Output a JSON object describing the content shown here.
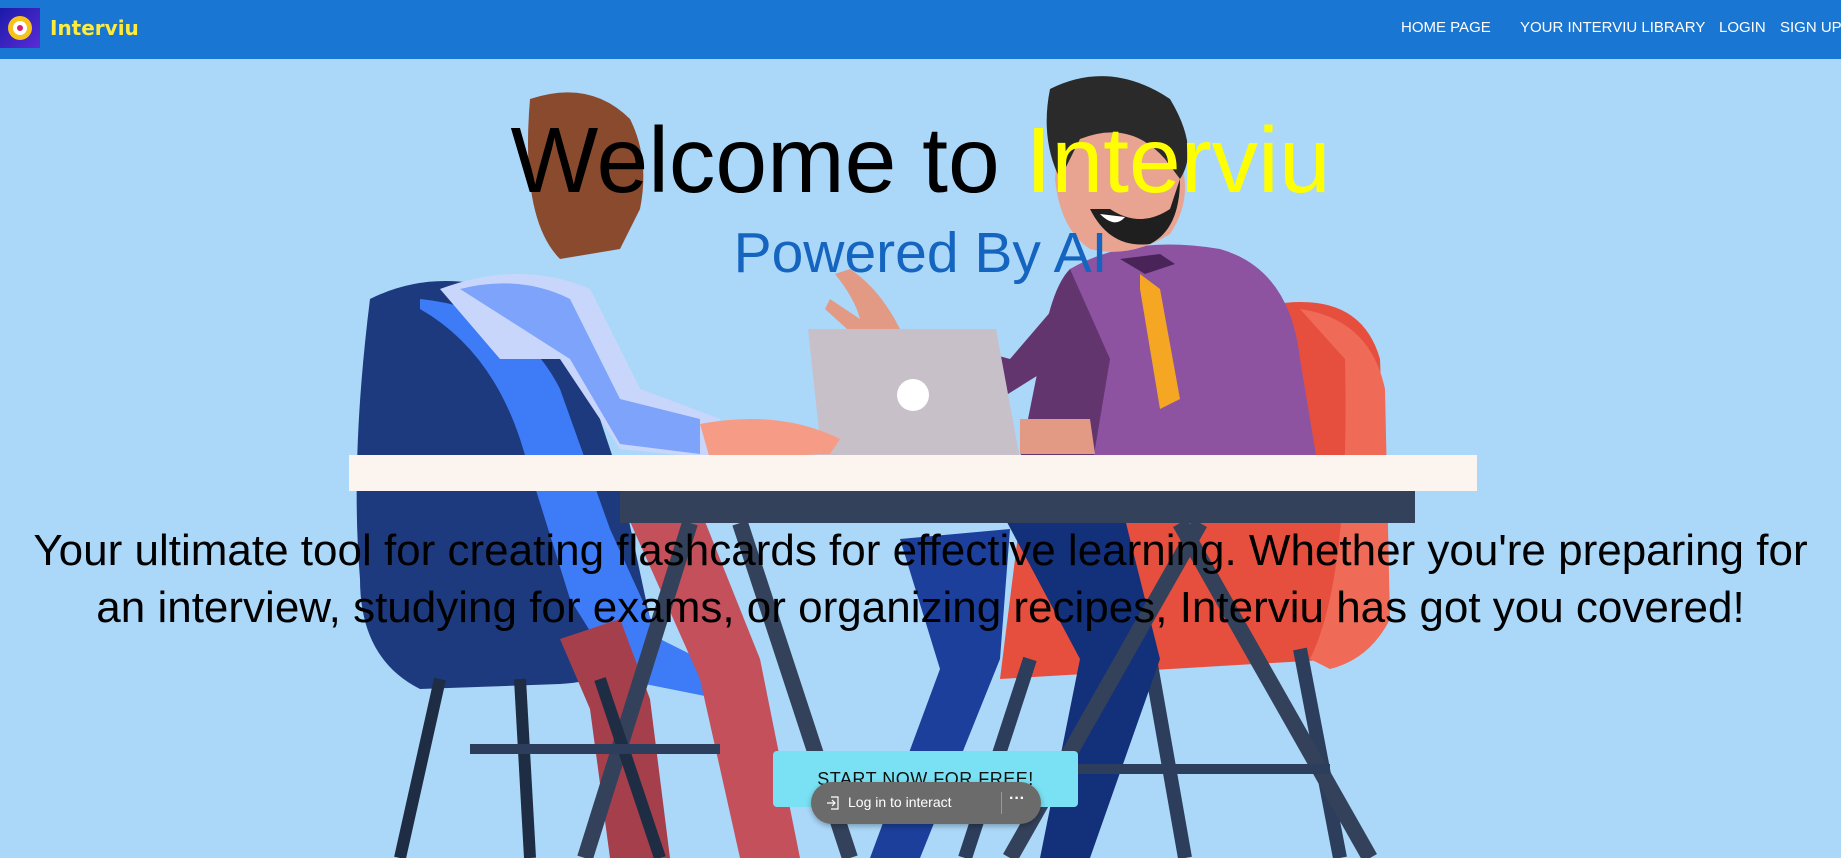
{
  "navbar": {
    "brand": "Interviu",
    "brand_color": "#ffeb3b",
    "background": "#1976d2",
    "links": [
      {
        "label": "HOME PAGE"
      },
      {
        "label": "YOUR INTERVIU LIBRARY"
      },
      {
        "label": "LOGIN"
      },
      {
        "label": "SIGN UP"
      }
    ]
  },
  "hero": {
    "title_prefix": "Welcome to ",
    "title_highlight": "Interviu",
    "highlight_color": "#ffff00",
    "subtitle": "Powered By AI",
    "description": "Your ultimate tool for creating flashcards for effective learning. Whether you're preparing for an interview, studying for exams, or organizing recipes, Interviu has got you covered!",
    "cta_label": "START NOW FOR FREE!"
  },
  "overlay": {
    "login_label": "Log in to interact",
    "more_label": "···"
  },
  "colors": {
    "page_background": "#abd8f9",
    "subtitle": "#1565c0",
    "cta_background": "#79e1f3"
  }
}
